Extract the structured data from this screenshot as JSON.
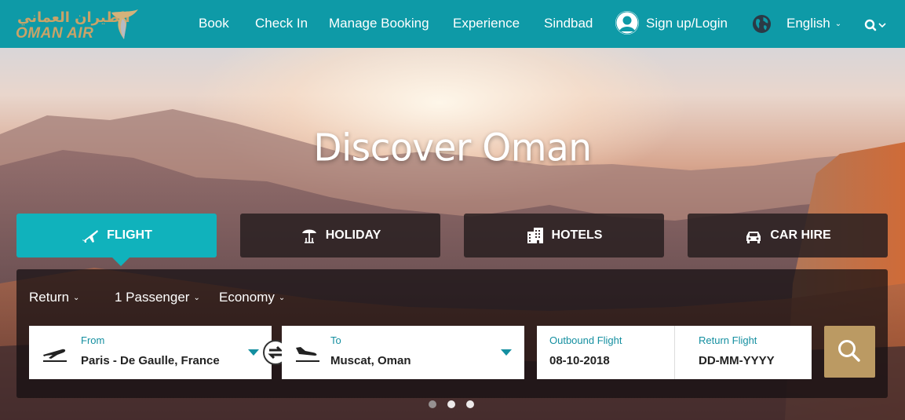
{
  "brand": {
    "arabic": "الطيران العماني",
    "english": "OMAN AIR",
    "gold": "#c9a368",
    "teal": "#0e9aa7"
  },
  "nav": {
    "items": [
      {
        "label": "Book"
      },
      {
        "label": "Check In"
      },
      {
        "label": "Manage Booking"
      },
      {
        "label": "Experience"
      },
      {
        "label": "Sindbad"
      }
    ],
    "login_label": "Sign up/Login",
    "language_label": "English",
    "icons": [
      "user-icon",
      "globe-icon",
      "search-icon",
      "chevron-down-icon"
    ]
  },
  "hero": {
    "title": "Discover Oman"
  },
  "tabs": [
    {
      "label": "FLIGHT",
      "icon": "plane-icon",
      "active": true
    },
    {
      "label": "HOLIDAY",
      "icon": "beach-umbrella-icon",
      "active": false
    },
    {
      "label": "HOTELS",
      "icon": "building-icon",
      "active": false
    },
    {
      "label": "CAR HIRE",
      "icon": "car-icon",
      "active": false
    }
  ],
  "booking": {
    "trip_type": "Return",
    "passengers": "1 Passenger",
    "cabin": "Economy",
    "from": {
      "label": "From",
      "value": "Paris - De Gaulle, France"
    },
    "to": {
      "label": "To",
      "value": "Muscat, Oman"
    },
    "outbound": {
      "label": "Outbound Flight",
      "value": "08-10-2018"
    },
    "return": {
      "label": "Return Flight",
      "value": "DD-MM-YYYY"
    },
    "accent": "#148fa0",
    "search_color": "#bb9a63"
  },
  "carousel": {
    "dots": 3,
    "current": 1
  }
}
